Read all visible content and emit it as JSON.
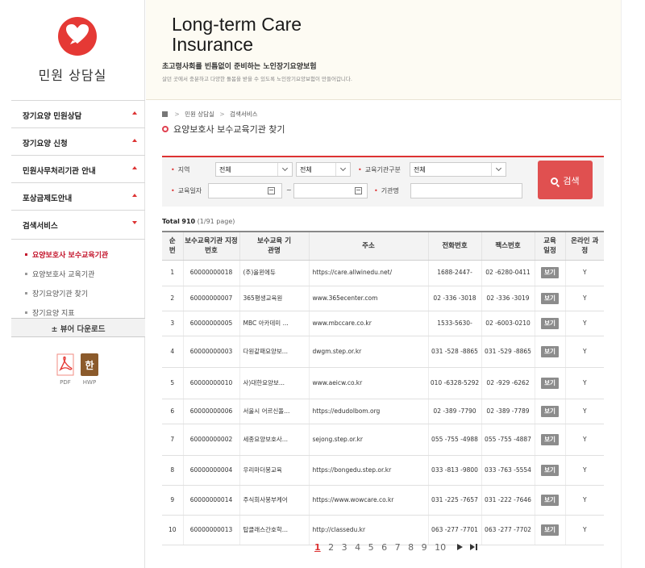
{
  "logo": {
    "title": "민원 상담실"
  },
  "banner": {
    "title": "Long-term Care Insurance",
    "subtitle": "초고령사회를 빈틈없이 준비하는 노인장기요양보험",
    "description": "살던 곳에서 충분하고 다양한 돌봄을 받을 수 있도록 노인장기요양보험이 만들어갑니다."
  },
  "menu": [
    {
      "label": "장기요양 민원상담"
    },
    {
      "label": "장기요양 신청"
    },
    {
      "label": "민원사무처리기관 안내"
    },
    {
      "label": "포상금제도안내"
    },
    {
      "label": "검색서비스"
    }
  ],
  "submenu": [
    {
      "label": "요양보호사 보수교육기관"
    },
    {
      "label": "요양보호사 교육기관"
    },
    {
      "label": "장기요양기관 찾기"
    },
    {
      "label": "장기요양 지표"
    }
  ],
  "viewer": {
    "label": "± 뷰어 다운로드",
    "pdf": "PDF",
    "hwp": "HWP",
    "hwp_glyph": "한"
  },
  "breadcrumb": {
    "items": [
      "민원 상담실",
      "검색서비스"
    ]
  },
  "page_title": "요양보호사 보수교육기관 찾기",
  "search": {
    "region_label": "지역",
    "region_value": "전체",
    "region_sub_value": "전체",
    "type_label": "교육기관구분",
    "type_value": "전체",
    "date_label": "교육일자",
    "tilde": "~",
    "org_label": "기관명",
    "button_label": "검색"
  },
  "summary": {
    "total_label": "Total",
    "total_count": "910",
    "pages": "(1/91 page)"
  },
  "table": {
    "headers": [
      "순번",
      "보수교육기관 지정번호",
      "보수교육 기관명",
      "주소",
      "전화번호",
      "팩스번호",
      "교육 일정",
      "온라인 과정"
    ],
    "rows": [
      {
        "no": "1",
        "code": "60000000018",
        "name": "(주)올윈에듀",
        "address": "https://care.allwinedu.net/",
        "phone": "1688-2447-",
        "fax": "02 -6280-0411",
        "schedule": "보기",
        "online": "Y"
      },
      {
        "no": "2",
        "code": "60000000007",
        "name": "365평생교육원",
        "address": "www.365ecenter.com",
        "phone": "02 -336 -3018",
        "fax": "02 -336 -3019",
        "schedule": "보기",
        "online": "Y"
      },
      {
        "no": "3",
        "code": "60000000005",
        "name": "MBC 아카데미 ...",
        "address": "www.mbccare.co.kr",
        "phone": "1533-5630-",
        "fax": "02 -6003-0210",
        "schedule": "보기",
        "online": "Y"
      },
      {
        "no": "4",
        "code": "60000000003",
        "name": "다원같패요양보...",
        "address": "dwgm.step.or.kr",
        "phone": "031 -528 -8865",
        "fax": "031 -529 -8865",
        "schedule": "보기",
        "online": "Y"
      },
      {
        "no": "5",
        "code": "60000000010",
        "name": "사)대한요양보...",
        "address": "www.aeicw.co.kr",
        "phone": "010 -6328-5292",
        "fax": "02 -929 -6262",
        "schedule": "보기",
        "online": "Y"
      },
      {
        "no": "6",
        "code": "60000000006",
        "name": "서울시 어르신돌...",
        "address": "https://edudolbom.org",
        "phone": "02 -389 -7790",
        "fax": "02 -389 -7789",
        "schedule": "보기",
        "online": "Y"
      },
      {
        "no": "7",
        "code": "60000000002",
        "name": "세종요양보호사...",
        "address": "sejong.step.or.kr",
        "phone": "055 -755 -4988",
        "fax": "055 -755 -4887",
        "schedule": "보기",
        "online": "Y"
      },
      {
        "no": "8",
        "code": "60000000004",
        "name": "우리마더봉교육",
        "address": "https://bongedu.step.or.kr",
        "phone": "033 -813 -9800",
        "fax": "033 -763 -5554",
        "schedule": "보기",
        "online": "Y"
      },
      {
        "no": "9",
        "code": "60000000014",
        "name": "주식회사봉부케어",
        "address": "https://www.wowcare.co.kr",
        "phone": "031 -225 -7657",
        "fax": "031 -222 -7646",
        "schedule": "보기",
        "online": "Y"
      },
      {
        "no": "10",
        "code": "60000000013",
        "name": "탑클래스간호학...",
        "address": "http://classedu.kr",
        "phone": "063 -277 -7701",
        "fax": "063 -277 -7702",
        "schedule": "보기",
        "online": "Y"
      }
    ]
  },
  "pagination": {
    "pages": [
      "1",
      "2",
      "3",
      "4",
      "5",
      "6",
      "7",
      "8",
      "9",
      "10"
    ],
    "current": "1"
  },
  "colors": {
    "accent": "#d33333",
    "button": "#e05050",
    "logo": "#e53935"
  }
}
